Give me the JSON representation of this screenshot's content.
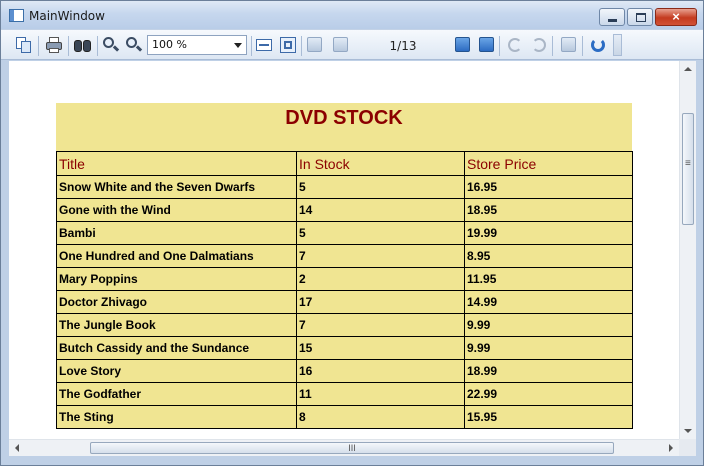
{
  "window": {
    "title": "MainWindow"
  },
  "toolbar": {
    "zoom_value": "100 %",
    "page_indicator": "1/13"
  },
  "report": {
    "title": "DVD STOCK",
    "columns": [
      "Title",
      "In Stock",
      "Store Price"
    ],
    "rows": [
      [
        "Snow White and the Seven Dwarfs",
        "5",
        "16.95"
      ],
      [
        "Gone with the Wind",
        "14",
        "18.95"
      ],
      [
        "Bambi",
        "5",
        "19.99"
      ],
      [
        "One Hundred and One Dalmatians",
        "7",
        "8.95"
      ],
      [
        "Mary Poppins",
        "2",
        "11.95"
      ],
      [
        "Doctor Zhivago",
        "17",
        "14.99"
      ],
      [
        "The Jungle Book",
        "7",
        "9.99"
      ],
      [
        "Butch Cassidy and the Sundance",
        "15",
        "9.99"
      ],
      [
        "Love Story",
        "16",
        "18.99"
      ],
      [
        "The Godfather",
        "11",
        "22.99"
      ],
      [
        "The Sting",
        "8",
        "15.95"
      ]
    ]
  },
  "colors": {
    "band": "#f0e592",
    "title_text": "#8b0000",
    "close_button": "#c43b1f"
  }
}
